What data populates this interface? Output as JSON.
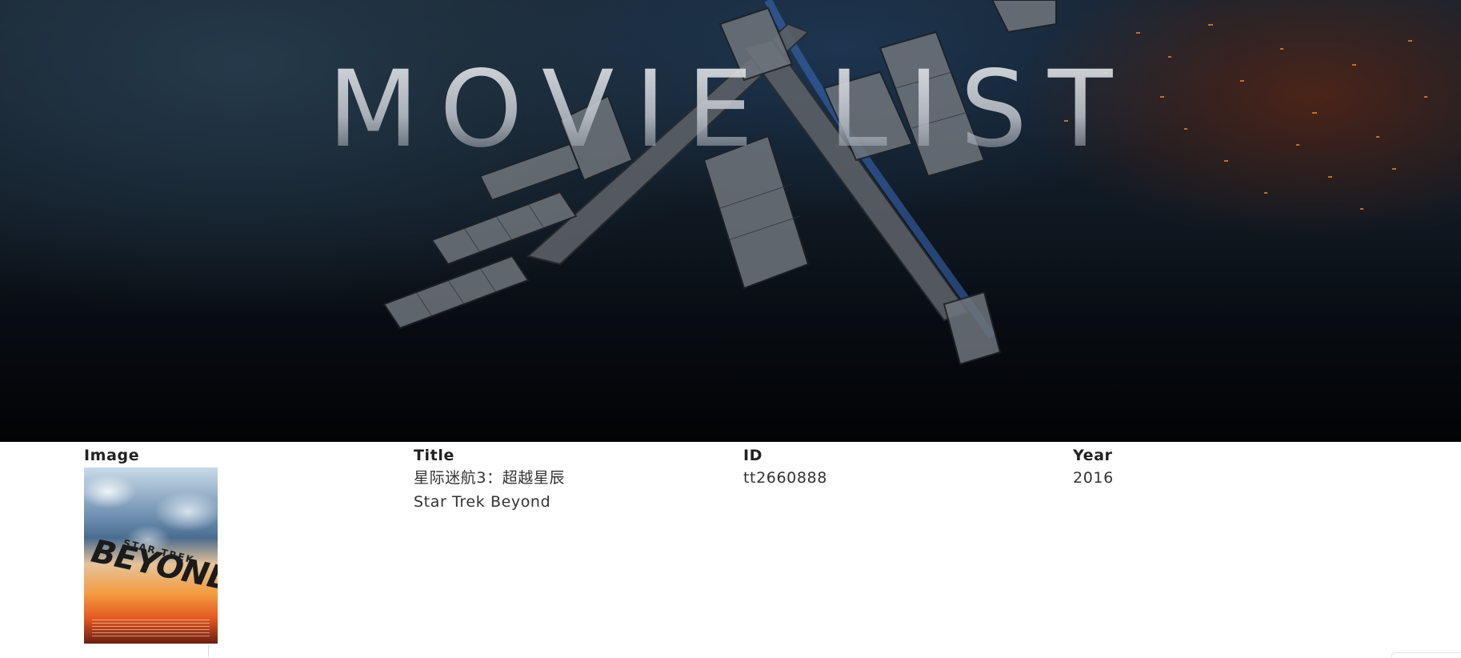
{
  "hero": {
    "title": "MOVIE LIST"
  },
  "table": {
    "headers": {
      "image": "Image",
      "title": "Title",
      "id": "ID",
      "year": "Year"
    },
    "rows": [
      {
        "poster": {
          "logo_text": "BEYOND",
          "logo_sub": "STAR TREK"
        },
        "title_cn": "星际迷航3：超越星辰",
        "title_en": "Star Trek Beyond",
        "id": "tt2660888",
        "year": "2016"
      }
    ]
  }
}
